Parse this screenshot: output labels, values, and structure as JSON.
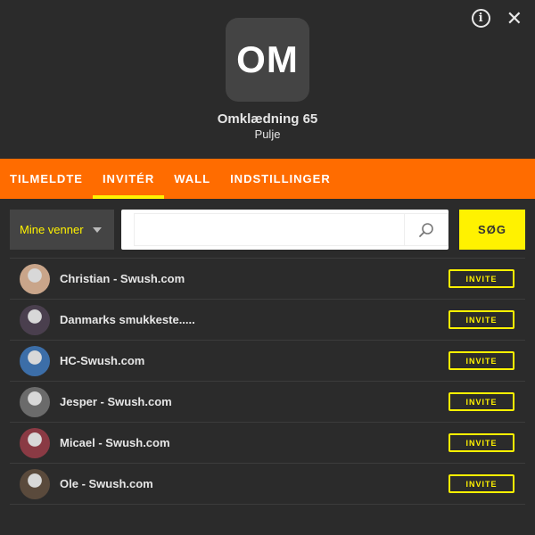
{
  "header": {
    "avatar_initials": "OM",
    "title": "Omklædning 65",
    "subtitle": "Pulje",
    "info_icon": "info-icon",
    "close_icon": "close-icon",
    "close_glyph": "✕",
    "info_glyph": "i"
  },
  "tabs": [
    {
      "label": "TILMELDTE",
      "active": false
    },
    {
      "label": "INVITÉR",
      "active": true
    },
    {
      "label": "WALL",
      "active": false
    },
    {
      "label": "INDSTILLINGER",
      "active": false
    }
  ],
  "controls": {
    "filter_selected": "Mine venner",
    "search_value": "",
    "search_placeholder": "",
    "search_button": "SØG"
  },
  "friends": [
    {
      "name": "Christian - Swush.com",
      "action": "INVITE",
      "avatar_color": "#c9a58a"
    },
    {
      "name": "Danmarks smukkeste.....",
      "action": "INVITE",
      "avatar_color": "#4a3f4e"
    },
    {
      "name": "HC-Swush.com",
      "action": "INVITE",
      "avatar_color": "#3c6ea8"
    },
    {
      "name": "Jesper - Swush.com",
      "action": "INVITE",
      "avatar_color": "#6b6b6b"
    },
    {
      "name": "Micael - Swush.com",
      "action": "INVITE",
      "avatar_color": "#8a3a44"
    },
    {
      "name": "Ole - Swush.com",
      "action": "INVITE",
      "avatar_color": "#5a4a3c"
    }
  ],
  "colors": {
    "accent": "#ff6c00",
    "highlight": "#fff200",
    "background": "#2b2b2b"
  }
}
